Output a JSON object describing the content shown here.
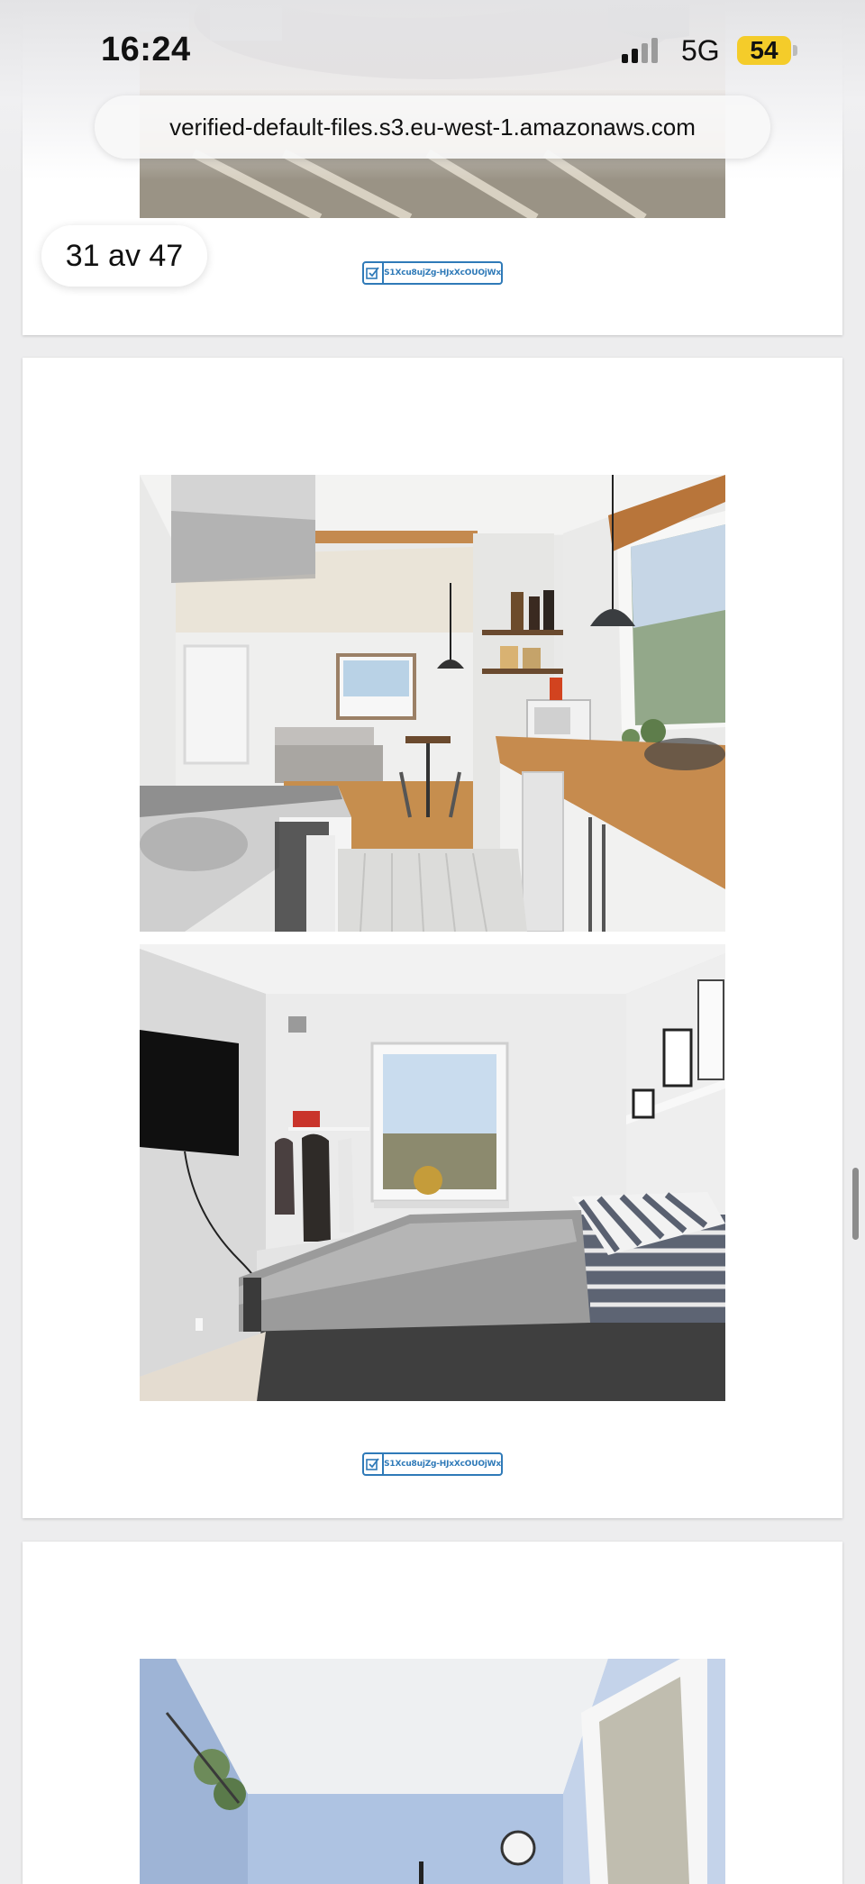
{
  "status_bar": {
    "time": "16:24",
    "network": "5G",
    "battery": "54"
  },
  "browser": {
    "url": "verified-default-files.s3.eu-west-1.amazonaws.com"
  },
  "viewer": {
    "page_counter": "31 av 47"
  },
  "pages": [
    {
      "stamp_code": "S1Xcu8ujZg-HJxXcOUOjWx"
    },
    {
      "stamp_code": "S1Xcu8ujZg-HJxXcOUOjWx"
    }
  ],
  "colors": {
    "stamp_blue": "#2f7ab8",
    "battery_yellow": "#f4cc2a"
  }
}
